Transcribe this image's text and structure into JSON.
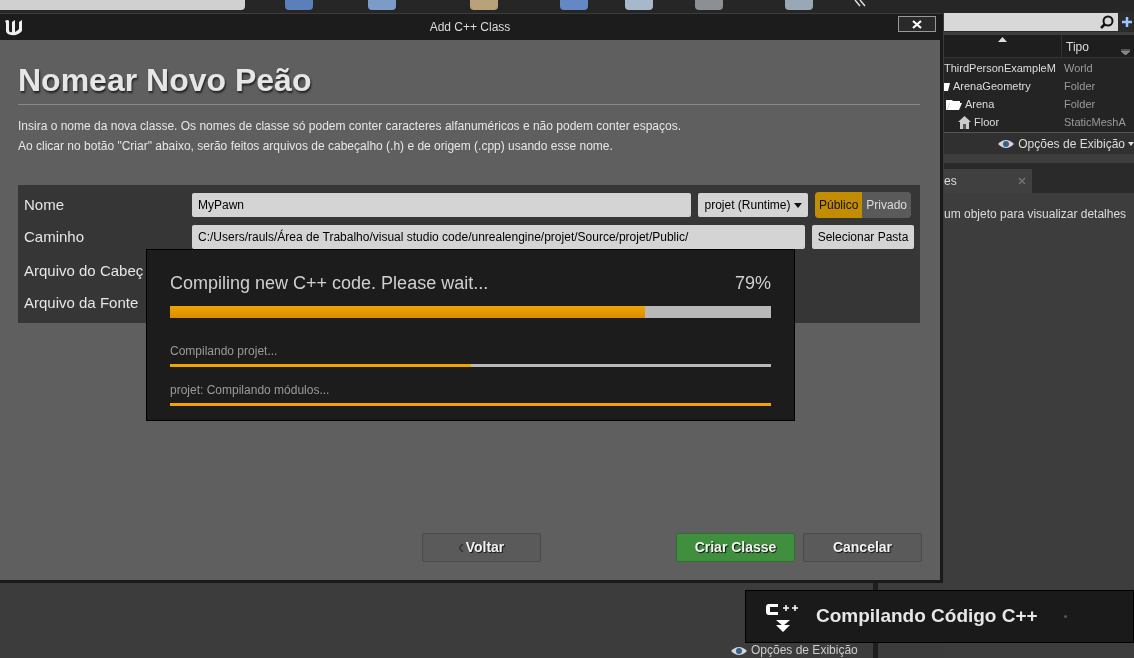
{
  "window": {
    "title": "Add C++ Class"
  },
  "heading": "Nomear Novo Peão",
  "description": [
    "Insira o nome da nova classe. Os nomes de classe só podem conter caracteres alfanuméricos e não podem conter espaços.",
    "Ao clicar no botão \"Criar\" abaixo, serão feitos arquivos de cabeçalho (.h) e de origem (.cpp) usando esse nome."
  ],
  "form": {
    "name_label": "Nome",
    "name_value": "MyPawn",
    "module": "projet (Runtime)",
    "visibility": [
      {
        "label": "Público",
        "selected": true
      },
      {
        "label": "Privado",
        "selected": false
      }
    ],
    "path_label": "Caminho",
    "path_value": "C:/Users/rauls/Área de Trabalho/visual studio code/unrealengine/projet/Source/projet/Public/",
    "path_button": "Selecionar Pasta",
    "header_label": "Arquivo do Cabeç",
    "source_label": "Arquivo da Fonte"
  },
  "progress": {
    "title": "Compiling new C++ code.  Please wait...",
    "reading": "79%",
    "level": 0.79,
    "tasks": [
      {
        "label": "Compilando projet...",
        "level": 0.5
      },
      {
        "label": "projet: Compilando módulos...",
        "level": 1
      }
    ]
  },
  "buttons": [
    {
      "label": "Voltar",
      "kind": "back"
    },
    {
      "label": "Criar Classe",
      "kind": "primary"
    },
    {
      "label": "Cancelar",
      "kind": "plain"
    }
  ],
  "outliner": {
    "column": "Tipo",
    "rows": [
      {
        "name": "ThirdPersonExampleM",
        "type": "World",
        "kind": "world"
      },
      {
        "name": "ArenaGeometry",
        "type": "Folder",
        "kind": "folder"
      },
      {
        "name": "Arena",
        "type": "Folder",
        "kind": "folder"
      },
      {
        "name": "Floor",
        "type": "StaticMeshA",
        "kind": "mesh"
      }
    ],
    "view_options": "Opções de Exibição"
  },
  "details": {
    "tab": "es",
    "hint": "um objeto para visualizar detalhes"
  },
  "bottom_view_options": "Opções de Exibição",
  "toast": {
    "text": "Compilando Código C++"
  }
}
